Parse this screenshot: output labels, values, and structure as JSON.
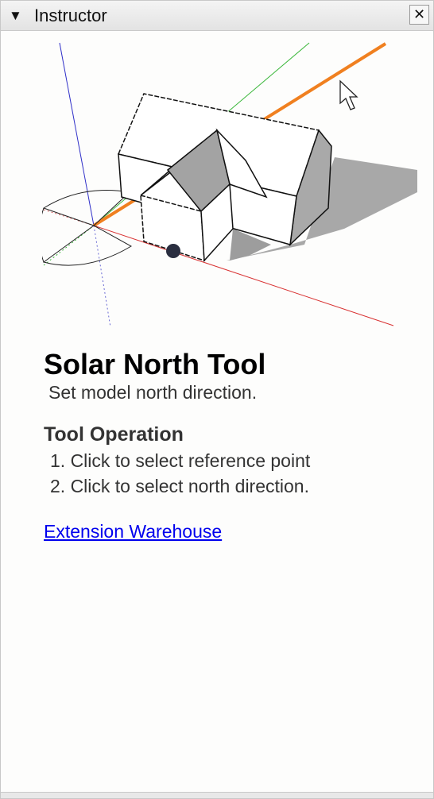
{
  "window": {
    "title": "Instructor",
    "collapse_icon": "▼",
    "close_icon": "✕"
  },
  "illustration": {
    "semantic": "solar-north-house-illustration"
  },
  "tool": {
    "title": "Solar North Tool",
    "description": "Set model north direction."
  },
  "operation": {
    "heading": "Tool Operation",
    "steps": [
      "1. Click to select reference point",
      "2. Click to select north direction."
    ]
  },
  "links": {
    "extension_warehouse": "Extension Warehouse"
  }
}
